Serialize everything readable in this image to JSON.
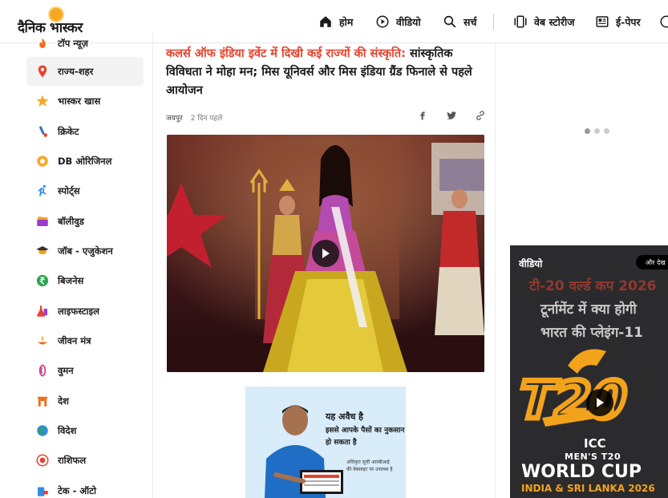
{
  "header": {
    "logo_text": "दैनिक भास्कर",
    "nav": [
      {
        "label": "होम",
        "icon": "home-icon"
      },
      {
        "label": "वीडियो",
        "icon": "play-circle-icon"
      },
      {
        "label": "सर्च",
        "icon": "search-icon"
      },
      {
        "label": "वेब स्टोरीज",
        "icon": "stories-icon"
      },
      {
        "label": "ई-पेपर",
        "icon": "newspaper-icon"
      }
    ]
  },
  "sidebar": {
    "items": [
      {
        "label": "टॉप न्यूज़",
        "icon": "fire-icon",
        "color": "#f26b1d"
      },
      {
        "label": "राज्य-शहर",
        "icon": "location-pin-icon",
        "color": "#e4432e"
      },
      {
        "label": "भास्कर खास",
        "icon": "star-icon",
        "color": "#f7a823"
      },
      {
        "label": "क्रिकेट",
        "icon": "cricket-icon",
        "color": "#3a6bc9"
      },
      {
        "label": "DB ओरिजिनल",
        "icon": "db-original-icon",
        "color": "#f7a823"
      },
      {
        "label": "स्पोर्ट्स",
        "icon": "running-icon",
        "color": "#2f8de4"
      },
      {
        "label": "बॉलीवुड",
        "icon": "clapperboard-icon",
        "color": "#9b3bd1"
      },
      {
        "label": "जॉब - एजुकेशन",
        "icon": "graduation-cap-icon",
        "color": "#333333"
      },
      {
        "label": "बिजनेस",
        "icon": "rupee-icon",
        "color": "#2ea44f"
      },
      {
        "label": "लाइफस्टाइल",
        "icon": "lifestyle-icon",
        "color": "#e4432e"
      },
      {
        "label": "जीवन मंत्र",
        "icon": "diya-icon",
        "color": "#f26b1d"
      },
      {
        "label": "वुमन",
        "icon": "women-icon",
        "color": "#d63384"
      },
      {
        "label": "देश",
        "icon": "india-gate-icon",
        "color": "#f26b1d"
      },
      {
        "label": "विदेश",
        "icon": "globe-icon",
        "color": "#2ea44f"
      },
      {
        "label": "राशिफल",
        "icon": "zodiac-icon",
        "color": "#e4432e"
      },
      {
        "label": "टेक - ऑटो",
        "icon": "tech-icon",
        "color": "#2f8de4"
      }
    ],
    "active_index": 1
  },
  "article": {
    "headline_red": "कलर्स ऑफ इंडिया इवेंट में दिखी कई राज्यों की संस्कृति:",
    "headline_rest": " सांस्कृतिक विविधता ने मोहा मन; मिस यूनिवर्स और मिस इंडिया ग्रैंड फिनाले से पहले आयोजन",
    "city": "जयपुर",
    "time": "2 दिन पहले",
    "share_icons": [
      "facebook-icon",
      "twitter-icon",
      "link-icon"
    ]
  },
  "ad": {
    "title": "यह अवैध है",
    "subtitle": "इससे आपके पैसों का नुकसान हो सकता है",
    "small": "अधिकृत सूची आरबीआई की वेबसाइट पर उपलब्ध है"
  },
  "video_card": {
    "label": "वीडियो",
    "more": "और देख",
    "line1": "टी-20 वर्ल्ड कप 2026",
    "line2": "टूर्नामेंट में क्या होगी",
    "line3": "भारत की प्लेइंग-11",
    "icc": "ICC",
    "mens": "MEN'S T20",
    "wc": "WORLD CUP",
    "host": "INDIA & SRI LANKA 2026"
  },
  "colors": {
    "accent_red": "#e4432e",
    "brand_orange": "#f7a823"
  }
}
